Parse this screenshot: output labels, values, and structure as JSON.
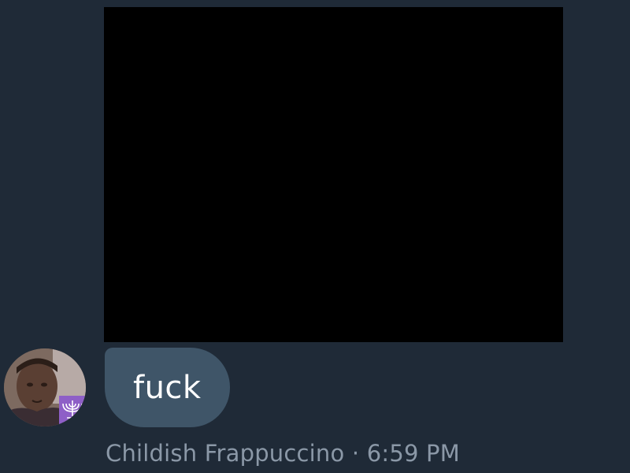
{
  "message": {
    "text": "fuck",
    "sender": "Childish Frappuccino",
    "separator": " · ",
    "time": "6:59 PM",
    "avatar_icon": "user-avatar-photo",
    "media_icon": "video-thumbnail"
  },
  "colors": {
    "background": "#1f2a37",
    "bubble": "#3f5568",
    "meta_text": "#8b98a7"
  }
}
